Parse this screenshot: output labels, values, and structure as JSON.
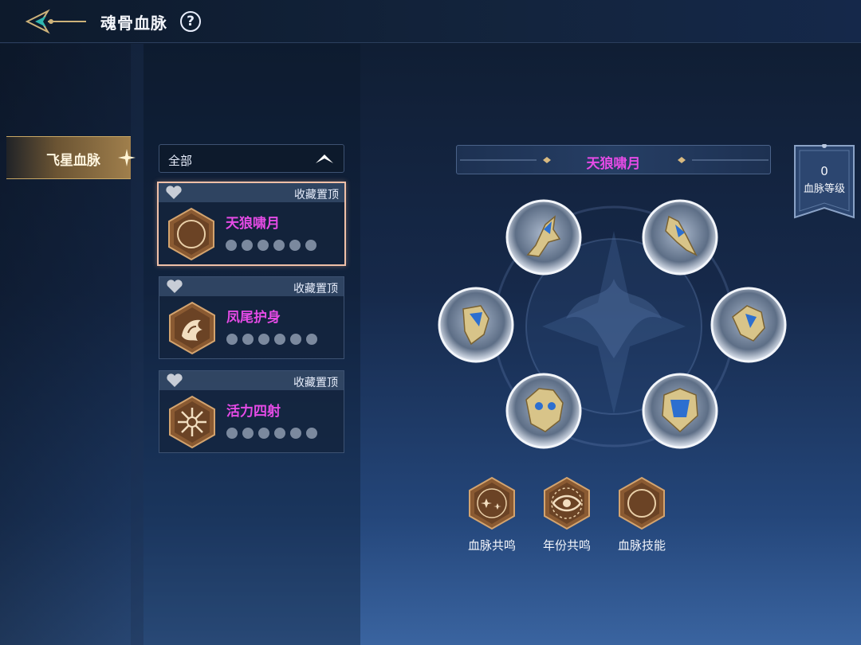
{
  "header": {
    "title": "魂骨血脉",
    "help": "?"
  },
  "sidebar": {
    "tab_label": "飞星血脉"
  },
  "filter": {
    "selected": "全部"
  },
  "cards": [
    {
      "pin_label": "收藏置顶",
      "name": "天狼啸月",
      "emblem": "crescent-moon-icon"
    },
    {
      "pin_label": "收藏置顶",
      "name": "凤尾护身",
      "emblem": "phoenix-tail-icon"
    },
    {
      "pin_label": "收藏置顶",
      "name": "活力四射",
      "emblem": "radiant-burst-icon"
    }
  ],
  "detail": {
    "title": "天狼啸月",
    "level_value": "0",
    "level_label": "血脉等级"
  },
  "bottom_buttons": [
    {
      "label": "血脉共鸣",
      "icon": "star-resonance-icon"
    },
    {
      "label": "年份共鸣",
      "icon": "eye-emblem-icon"
    },
    {
      "label": "血脉技能",
      "icon": "crescent-moon-icon"
    }
  ],
  "colors": {
    "accent_name": "#e54be6",
    "gold": "#c9a865",
    "bronze": "#9b6a3e"
  }
}
